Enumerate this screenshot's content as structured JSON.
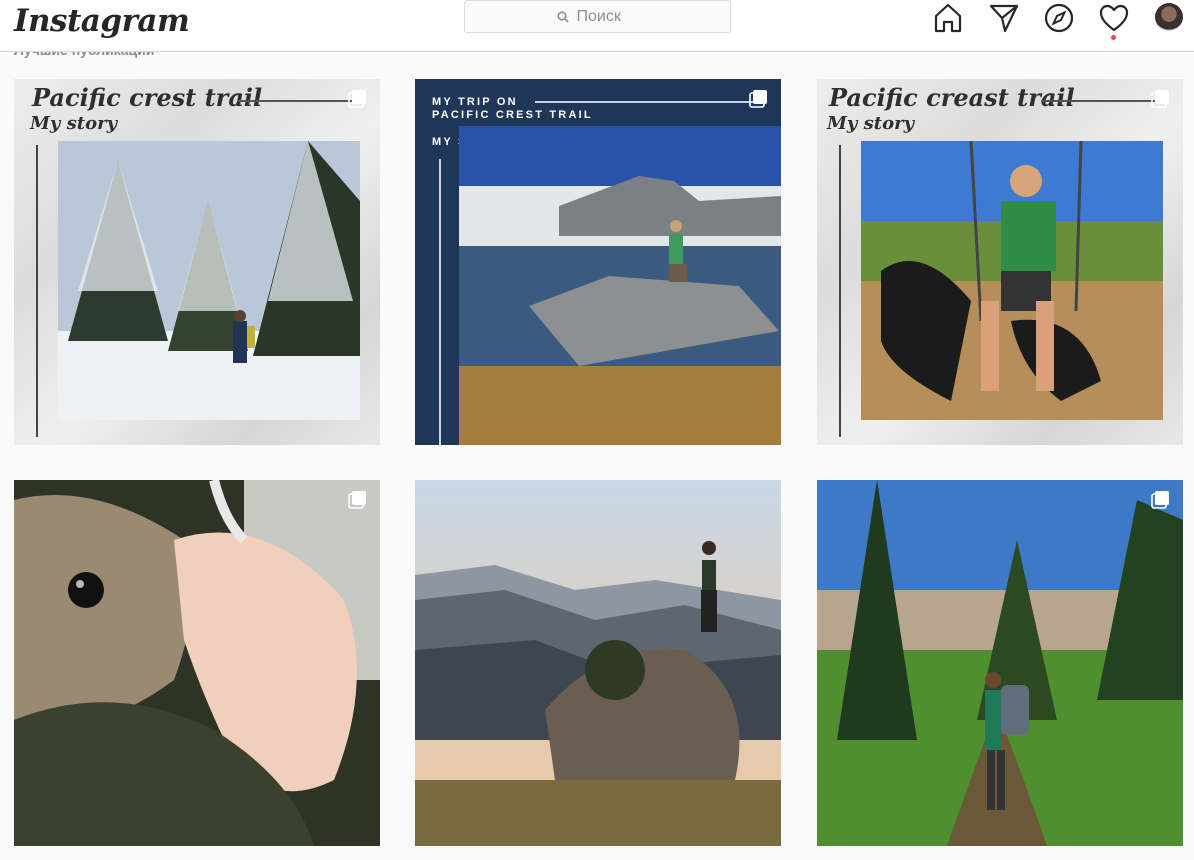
{
  "app": {
    "logo": "Instagram"
  },
  "search": {
    "placeholder": "Поиск",
    "icon": "search-icon"
  },
  "nav": {
    "icons": [
      "home-icon",
      "direct-messages-icon",
      "explore-icon",
      "activity-heart-icon",
      "profile-avatar"
    ],
    "has_notification": true,
    "notification_color": "#ed4956"
  },
  "section": {
    "label": "Лучшие публикации"
  },
  "posts": [
    {
      "title": "Pacific crest trail",
      "subtitle": "My story",
      "multiple": true
    },
    {
      "title": "MY TRIP ON\nPACIFIC CREST TRAIL",
      "subtitle": "MY STORY",
      "multiple": true
    },
    {
      "title": "Pacific creast trail",
      "subtitle": "My story",
      "multiple": true
    },
    {
      "multiple": true
    },
    {
      "multiple": false
    },
    {
      "multiple": true
    }
  ],
  "colors": {
    "navy_template": "#1f3658",
    "border": "#dbdbdb",
    "background": "#fafafa"
  }
}
